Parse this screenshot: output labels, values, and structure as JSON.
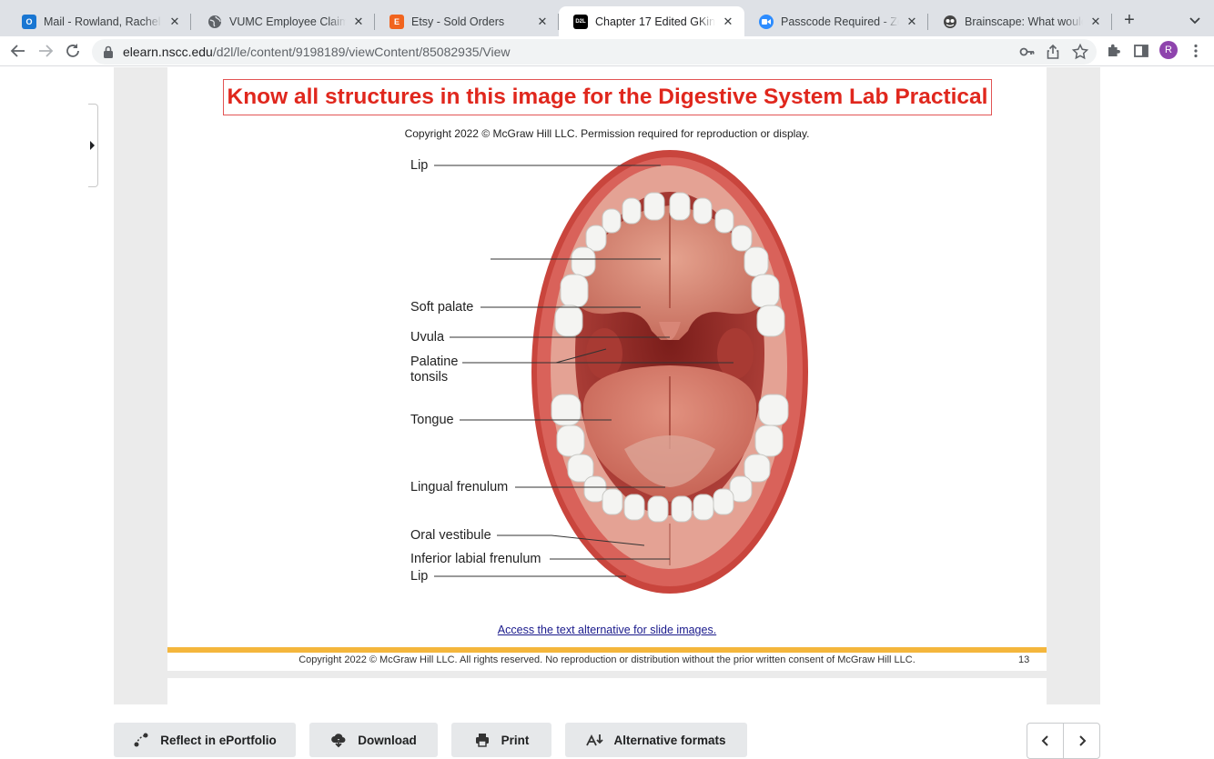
{
  "browser": {
    "tabs": [
      {
        "title": "Mail - Rowland, Rachel - Outlook",
        "icon": "outlook-icon",
        "color": "#1976d2"
      },
      {
        "title": "VUMC Employee Claim",
        "icon": "globe-icon",
        "color": "#5f6368"
      },
      {
        "title": "Etsy - Sold Orders",
        "icon": "etsy-icon",
        "color": "#f1641e"
      },
      {
        "title": "Chapter 17 Edited GKing - D2L",
        "icon": "d2l-icon",
        "color": "#000000",
        "active": true
      },
      {
        "title": "Passcode Required - Zoom",
        "icon": "zoom-icon",
        "color": "#2d8cff"
      },
      {
        "title": "Brainscape: What would you like",
        "icon": "brainscape-icon",
        "color": "#333333"
      }
    ],
    "favicon_text": {
      "etsy": "E",
      "d2l": "D2L"
    },
    "url_host": "elearn.nscc.edu",
    "url_path": "/d2l/le/content/9198189/viewContent/85082935/View",
    "profile_initial": "R"
  },
  "slide": {
    "title": "Know all structures in this image for the Digestive System Lab Practical",
    "copyright": "Copyright 2022 © McGraw Hill LLC. Permission required for reproduction or display.",
    "labels": {
      "lip_top": "Lip",
      "soft_palate": "Soft palate",
      "uvula": "Uvula",
      "palatine_tonsils": "Palatine tonsils",
      "tongue": "Tongue",
      "lingual_frenulum": "Lingual frenulum",
      "oral_vestibule": "Oral vestibule",
      "inferior_labial_frenulum": "Inferior labial frenulum",
      "lip_bottom": "Lip"
    },
    "alt_link": "Access the text alternative for slide images.",
    "footer": "Copyright 2022 © McGraw Hill LLC. All rights reserved. No reproduction or distribution without the prior written consent of McGraw Hill LLC.",
    "page_number": "13",
    "accent_color": "#f4b63c",
    "title_color": "#e0271d"
  },
  "actions": {
    "reflect": "Reflect in ePortfolio",
    "download": "Download",
    "print": "Print",
    "alternative_formats": "Alternative formats"
  }
}
